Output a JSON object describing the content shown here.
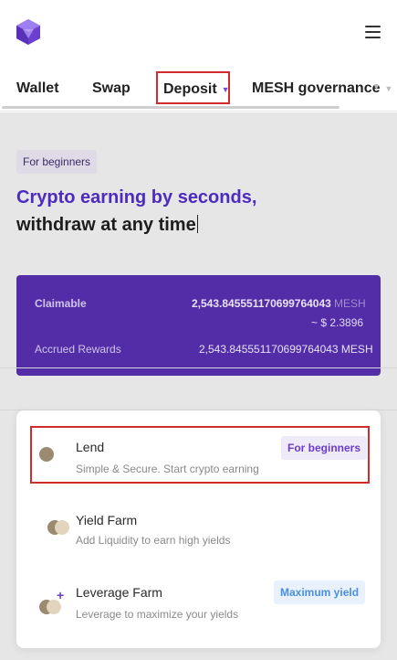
{
  "header": {
    "logo_icon": "hexagon-logo-icon",
    "menu_icon": "hamburger-menu-icon"
  },
  "tabs": [
    {
      "label": "Wallet"
    },
    {
      "label": "Swap"
    },
    {
      "label": "Deposit",
      "dropdown": true
    },
    {
      "label": "MESH governance",
      "dropdown": true
    }
  ],
  "hero": {
    "pill": "For beginners",
    "headline_line1": "Crypto earning by seconds,",
    "headline_line2": "withdraw at any time"
  },
  "rewards": {
    "claimable_label": "Claimable",
    "claimable_value": "2,543.845551170699764043",
    "claimable_unit": "MESH",
    "claimable_usd": "~ $ 2.3896",
    "accrued_label": "Accrued Rewards",
    "accrued_value": "2,543.845551170699764043 MESH"
  },
  "menu": {
    "items": [
      {
        "title": "Lend",
        "subtitle": "Simple & Secure. Start crypto earning",
        "badge": "For beginners"
      },
      {
        "title": "Yield Farm",
        "subtitle": "Add Liquidity to earn high yields",
        "badge": ""
      },
      {
        "title": "Leverage Farm",
        "subtitle": "Leverage to maximize your yields",
        "badge": "Maximum yield"
      }
    ]
  },
  "colors": {
    "brand_purple": "#532da8",
    "headline_purple": "#4d2bbf",
    "highlight_red": "#d12c2c",
    "token_brown": "#9a8a70",
    "token_beige": "#e3d4bd"
  }
}
